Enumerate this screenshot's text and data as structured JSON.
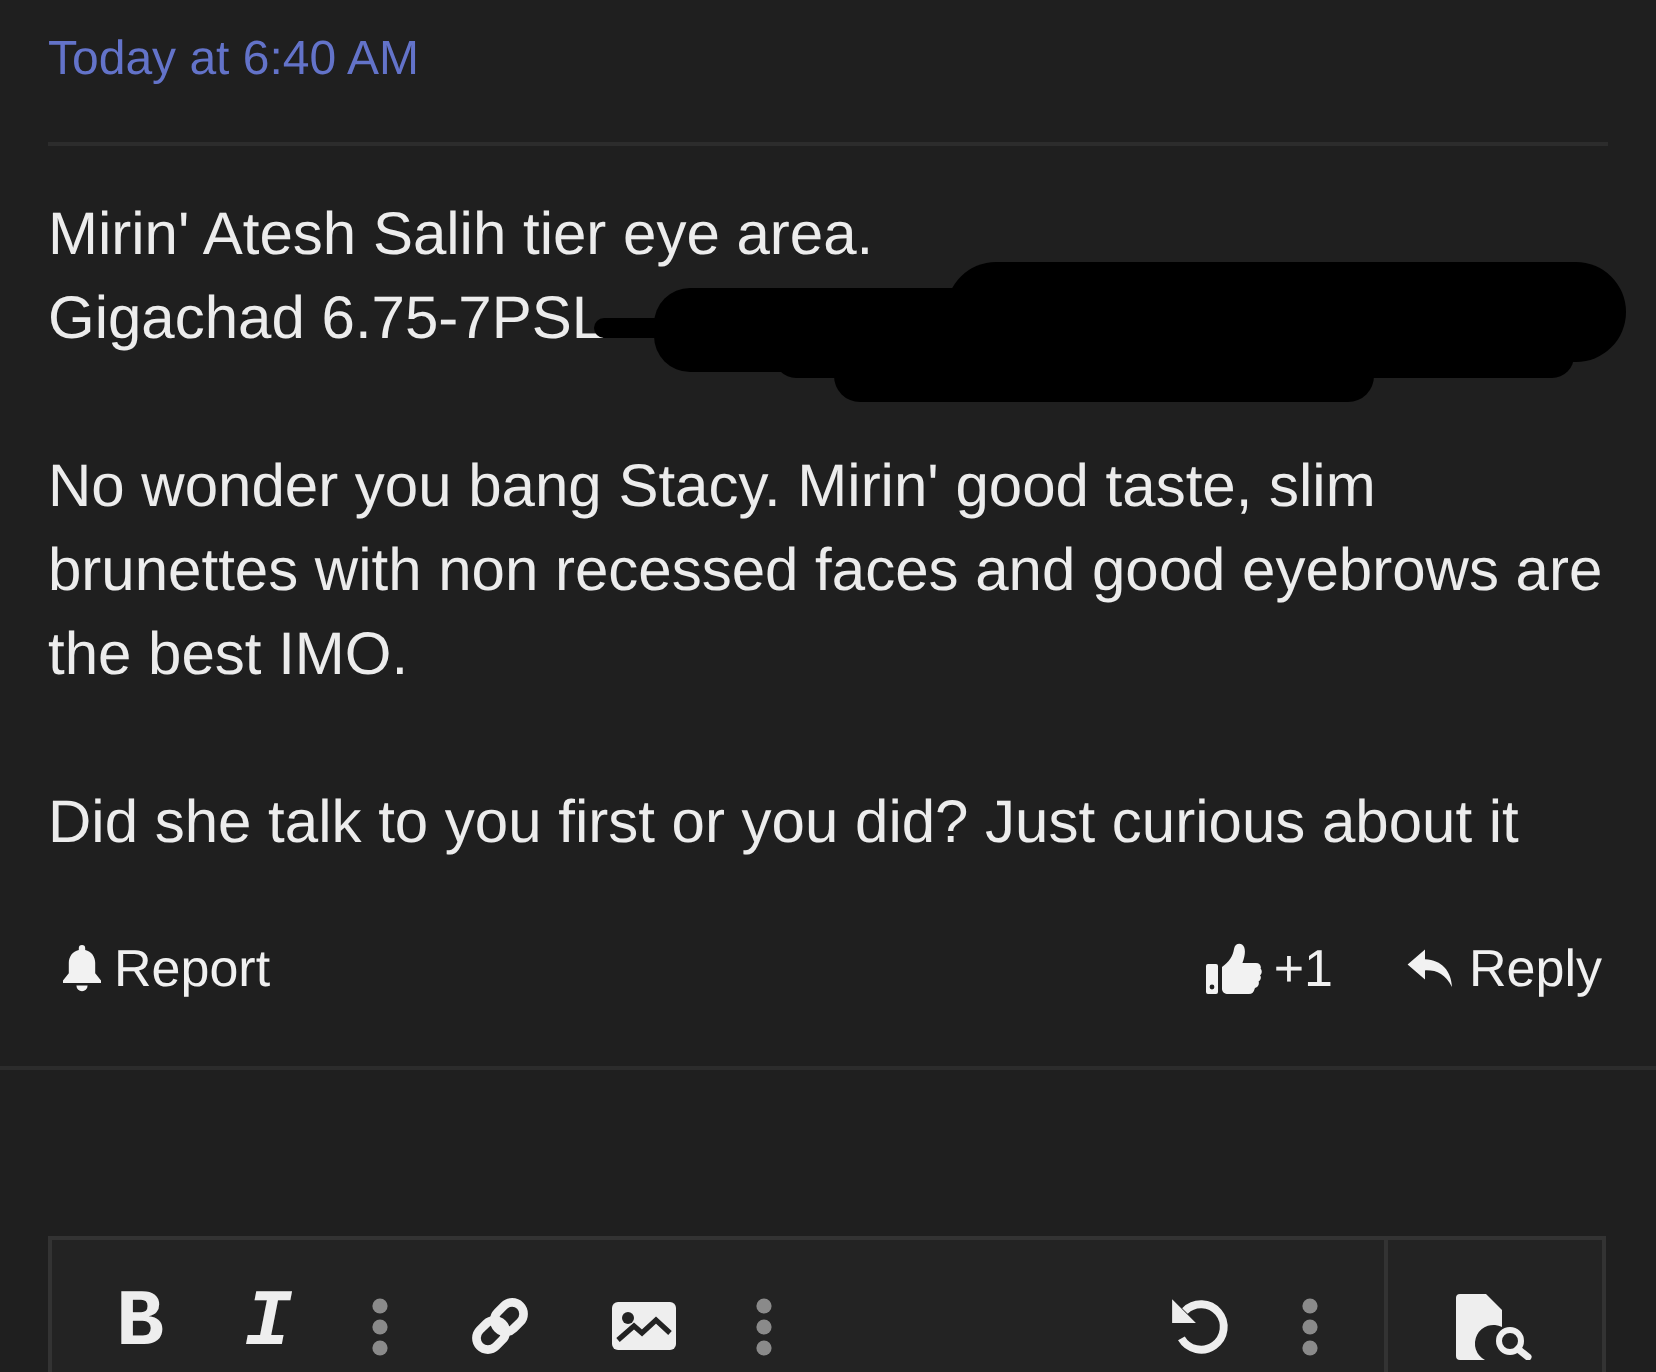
{
  "post": {
    "timestamp": "Today at 6:40 AM",
    "paragraphs": [
      {
        "lines": [
          {
            "text": "Mirin' Atesh Salih tier eye area.",
            "redacted": false
          },
          {
            "text": "Gigachad 6.75-7PSL",
            "redacted": true
          }
        ]
      },
      {
        "lines": [
          {
            "text": "No wonder you bang Stacy. Mirin' good taste, slim brunettes with non recessed faces and good eyebrows are the best IMO.",
            "redacted": false
          }
        ]
      },
      {
        "lines": [
          {
            "text": "Did she talk to you first or you did? Just curious about it",
            "redacted": false
          }
        ]
      }
    ],
    "actions": {
      "report": "Report",
      "reaction_count": "+1",
      "reply": "Reply"
    }
  },
  "editor": {
    "formatting": [
      {
        "kind": "bold",
        "label": "B"
      },
      {
        "kind": "italic",
        "label": "I"
      },
      {
        "kind": "more"
      },
      {
        "kind": "link"
      },
      {
        "kind": "image"
      },
      {
        "kind": "more"
      }
    ],
    "history": [
      {
        "kind": "undo"
      },
      {
        "kind": "more"
      }
    ],
    "preview": [
      {
        "kind": "preview"
      }
    ]
  }
}
